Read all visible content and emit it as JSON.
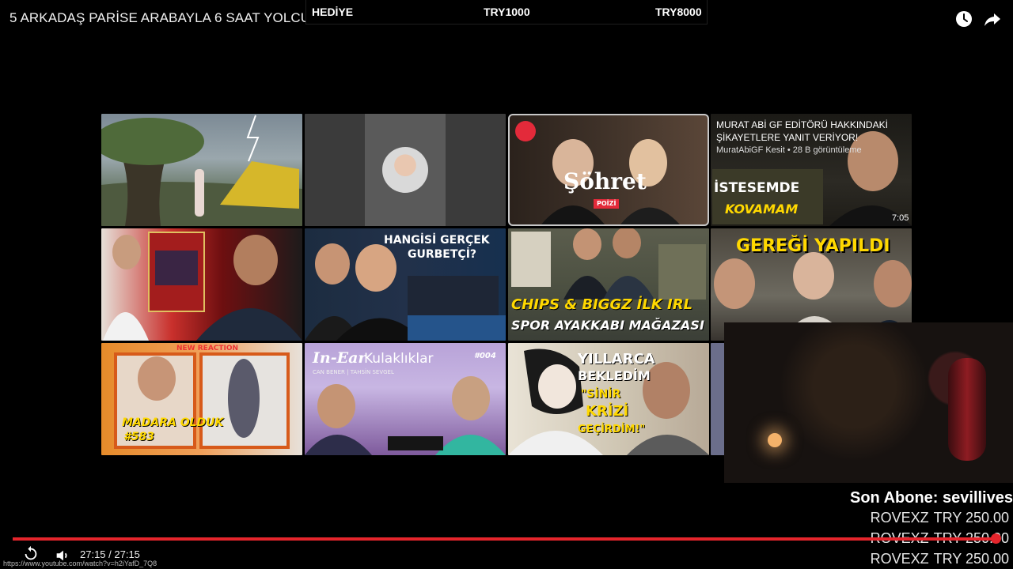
{
  "video": {
    "title": "5 ARKADAŞ PARİSE ARABAYLA 6 SAAT YOLCU"
  },
  "donation_bar": {
    "gift_label": "HEDİYE",
    "mid_amount": "TRY1000",
    "max_amount": "TRY8000"
  },
  "top_icons": [
    "clock-icon",
    "share-icon"
  ],
  "grid": {
    "tiles": [
      {
        "id": "tent-storm",
        "lines": []
      },
      {
        "id": "avatar-placeholder",
        "lines": []
      },
      {
        "id": "sohret",
        "badge": "POİZİ",
        "lines": [
          "Şöhret"
        ]
      },
      {
        "id": "murat-abi",
        "hover_title_1": "MURAT ABİ GF EDİTÖRÜ HAKKINDAKİ",
        "hover_title_2": "ŞİKAYETLERE YANIT VERİYOR!",
        "hover_meta": "MuratAbiGF Kesit • 28 B görüntüleme",
        "lines": [
          "İSTESEMDE",
          "KOVAMAM"
        ],
        "duration": "7:05"
      },
      {
        "id": "card-reaction",
        "lines": []
      },
      {
        "id": "gurbetci",
        "lines": [
          "HANGİSİ GERÇEK",
          "GURBETÇİ?"
        ]
      },
      {
        "id": "chips-biggz",
        "lines": [
          "CHIPS & BIGGZ İLK IRL",
          "SPOR AYAKKABI MAĞAZASI"
        ]
      },
      {
        "id": "geregi",
        "lines": [
          "GEREĞİ YAPILDI"
        ]
      },
      {
        "id": "madara",
        "label": "NEW REACTION",
        "lines": [
          "MADARA OLDUK",
          "#583"
        ]
      },
      {
        "id": "in-ear",
        "names": "CAN BENER | TAHSİN SEVGEL",
        "number": "#004",
        "lines": [
          "In-Ear",
          "Kulaklıklar"
        ]
      },
      {
        "id": "yillarca",
        "lines": [
          "YILLARCA",
          "BEKLEDİM",
          "\"SİNİR",
          "KRİZİ",
          "GEÇİRDİM!\""
        ]
      }
    ]
  },
  "overlay": {
    "subscriber_label": "Son Abone: sevillives",
    "recent_donations": [
      {
        "name": "ROVEXZ",
        "amount": "TRY 250.00"
      },
      {
        "name": "ROVEXZ",
        "amount": "TRY 250.00"
      },
      {
        "name": "ROVEXZ",
        "amount": "TRY 250.00"
      }
    ]
  },
  "player": {
    "progress_fraction": 0.995,
    "time_display": "27:15 / 27:15",
    "status_url": "https://www.youtube.com/watch?v=h2iYafD_7Q8"
  },
  "colors": {
    "progress": "#e5252c",
    "accent_yellow": "#ffd800",
    "background": "#000000"
  }
}
